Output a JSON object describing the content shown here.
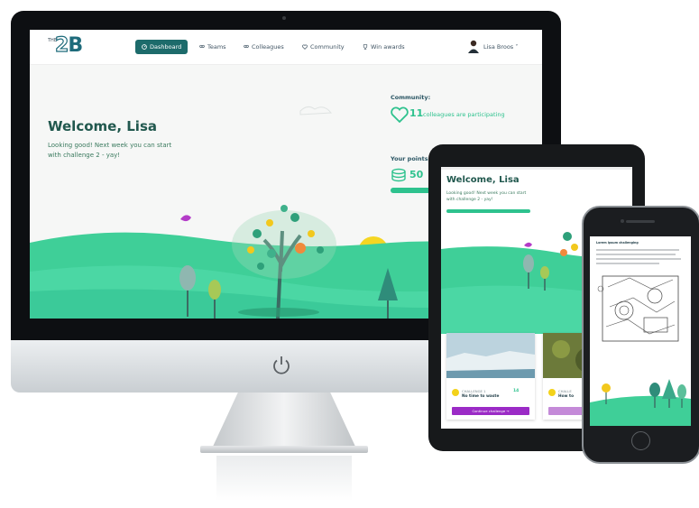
{
  "desktop": {
    "logo": {
      "small": "THE",
      "two": "2",
      "b": "B"
    },
    "nav": [
      {
        "label": "Dashboard",
        "icon": "dashboard-icon",
        "active": true
      },
      {
        "label": "Teams",
        "icon": "teams-icon"
      },
      {
        "label": "Colleagues",
        "icon": "colleagues-icon"
      },
      {
        "label": "Community",
        "icon": "heart-icon"
      },
      {
        "label": "Win awards",
        "icon": "trophy-icon"
      }
    ],
    "user": {
      "name": "Lisa Broos ˅"
    },
    "welcome": "Welcome, Lisa",
    "subtitle_line1": "Looking good! Next week you can start",
    "subtitle_line2": "with challenge 2 - yay!",
    "community": {
      "label": "Community:",
      "count": "11",
      "text": "colleagues are participating"
    },
    "points": {
      "label": "Your points:",
      "value": "50",
      "progress": 0.9
    }
  },
  "tablet": {
    "welcome": "Welcome, Lisa",
    "subtitle_line1": "Looking good! Next week you can start",
    "subtitle_line2": "with challenge 2 - yay!",
    "cards": [
      {
        "challenge": "CHALLENGE 1",
        "title": "No time to waste",
        "points": "14",
        "button": "Continue challenge  →"
      },
      {
        "challenge": "CHALLE",
        "title": "How to"
      }
    ]
  },
  "phone": {
    "title": "Lorem ipsum challenging"
  },
  "colors": {
    "accent": "#2ec28e",
    "primary": "#1d6b6b",
    "button": "#9b2bc6"
  }
}
